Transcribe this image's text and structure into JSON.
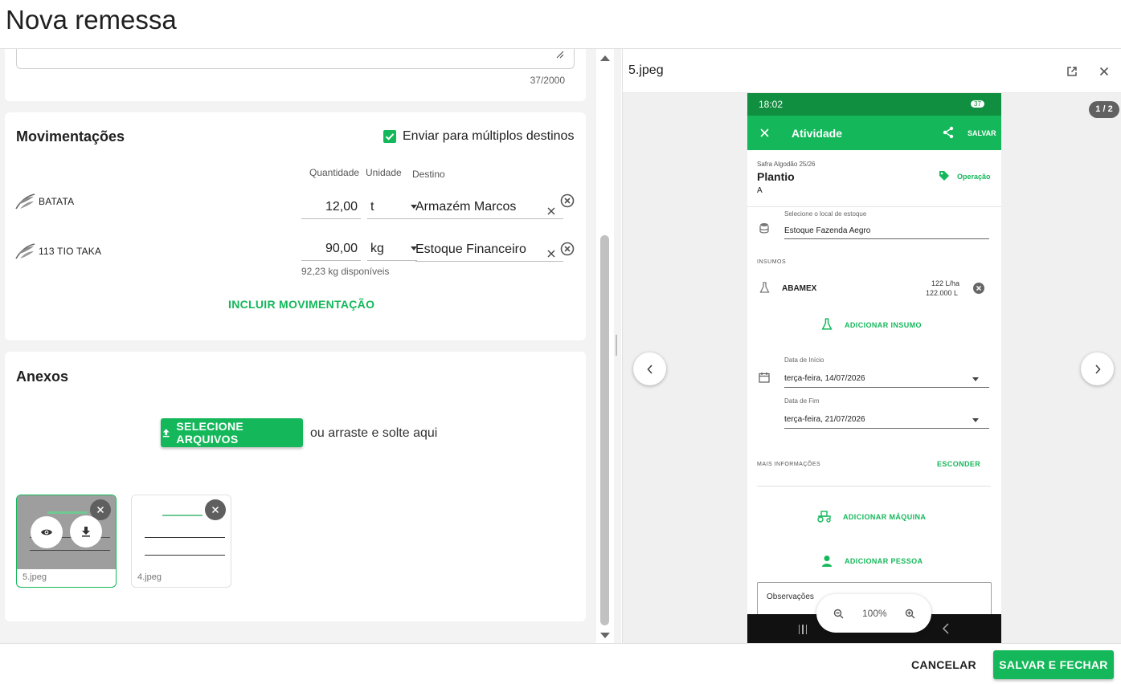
{
  "header": {
    "title": "Nova remessa"
  },
  "notes": {
    "counter": "37/2000"
  },
  "movements": {
    "title": "Movimentações",
    "multi_dest_label": "Enviar para múltiplos destinos",
    "columns": {
      "quantity": "Quantidade",
      "unit": "Unidade",
      "destination": "Destino"
    },
    "rows": [
      {
        "name": "BATATA",
        "quantity": "12,00",
        "unit": "t",
        "destination": "Armazém Marcos",
        "hint": ""
      },
      {
        "name": "113 TIO TAKA",
        "quantity": "90,00",
        "unit": "kg",
        "destination": "Estoque Financeiro",
        "hint": "92,23 kg disponíveis"
      }
    ],
    "add_label": "INCLUIR MOVIMENTAÇÃO"
  },
  "attachments": {
    "title": "Anexos",
    "select_label": "SELECIONE ARQUIVOS",
    "drag_hint": "ou arraste e solte aqui",
    "files": [
      {
        "name": "5.jpeg"
      },
      {
        "name": "4.jpeg"
      }
    ]
  },
  "viewer": {
    "filename": "5.jpeg",
    "page_indicator": "1 / 2",
    "zoom": "100%",
    "phone": {
      "time": "18:02",
      "battery": "37",
      "title": "Atividade",
      "save": "SALVAR",
      "season": "Safra Algodão 25/26",
      "activity": "Plantio",
      "activity_sub": "A",
      "operation": "Operação",
      "stock_label": "Selecione o local de estoque",
      "stock_value": "Estoque Fazenda Aegro",
      "inputs_label": "INSUMOS",
      "input_name": "ABAMEX",
      "input_rate": "122 L/ha",
      "input_total": "122.000 L",
      "add_input": "ADICIONAR INSUMO",
      "start_label": "Data de Início",
      "start_value": "terça-feira, 14/07/2026",
      "end_label": "Data de Fim",
      "end_value": "terça-feira, 21/07/2026",
      "more_info": "MAIS INFORMAÇÕES",
      "hide": "ESCONDER",
      "add_machine": "ADICIONAR MÁQUINA",
      "add_person": "ADICIONAR PESSOA",
      "observations": "Observações"
    }
  },
  "footer": {
    "cancel": "CANCELAR",
    "save_close": "SALVAR E FECHAR"
  },
  "colors": {
    "primary": "#14b85a",
    "phone_bar": "#0f8f3f",
    "phone_header": "#14b85a"
  }
}
